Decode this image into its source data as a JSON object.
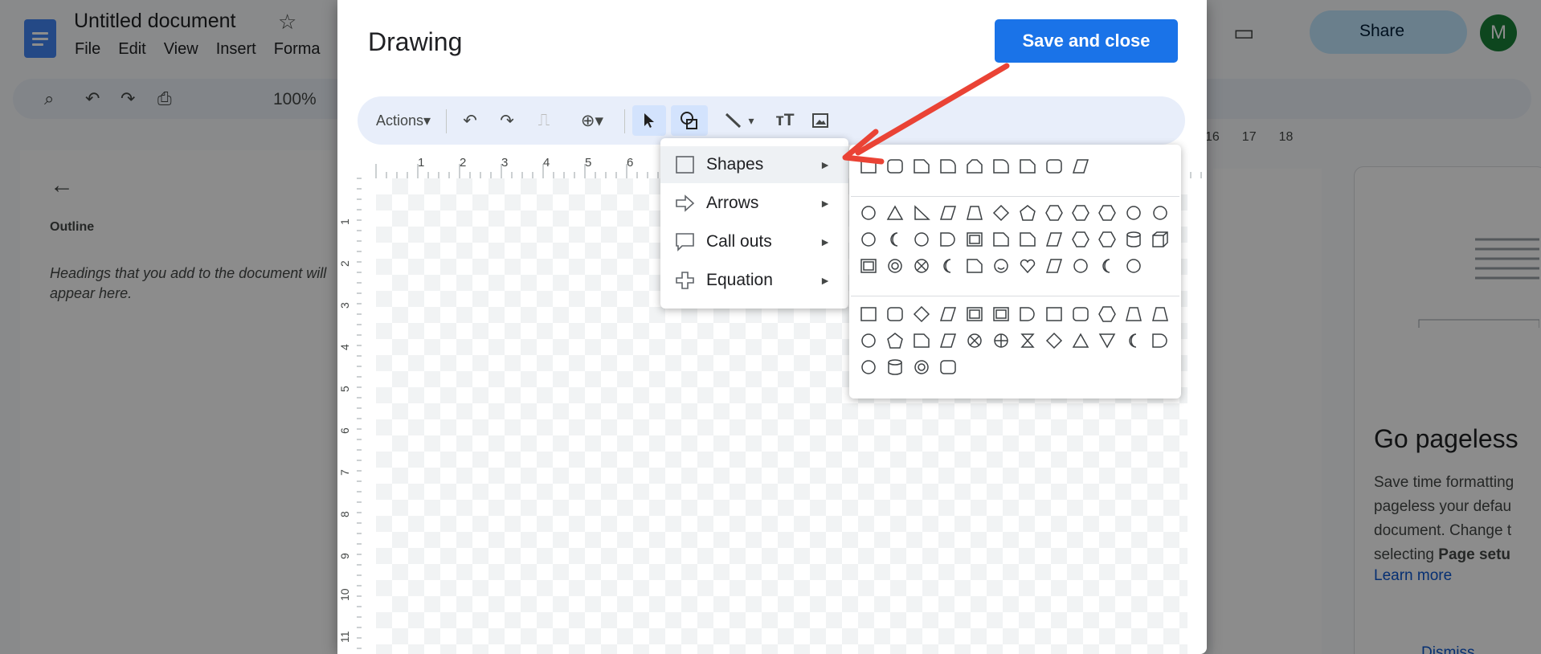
{
  "doc": {
    "title": "Untitled document",
    "menu": [
      "File",
      "Edit",
      "View",
      "Insert",
      "Forma"
    ],
    "zoom": "100%",
    "share_label": "Share",
    "avatar_letter": "M",
    "outline_title": "Outline",
    "outline_text": "Headings that you add to the document will appear here.",
    "ruler_right": [
      "16",
      "17",
      "18"
    ]
  },
  "pageless": {
    "title": "Go pageless",
    "text_line1": "Save time formatting",
    "text_line2": "pageless your defau",
    "text_line3": "document. Change t",
    "text_line4": "selecting ",
    "text_bold": "Page setu",
    "link": "Learn more",
    "dismiss": "Dismiss"
  },
  "drawing": {
    "title": "Drawing",
    "save_label": "Save and close",
    "actions_label": "Actions",
    "h_ruler": [
      "1",
      "2",
      "3",
      "4",
      "5",
      "6"
    ],
    "v_ruler": [
      "1",
      "2",
      "3",
      "4",
      "5",
      "6",
      "7",
      "8",
      "9",
      "10",
      "11"
    ]
  },
  "shape_menu": {
    "items": [
      {
        "label": "Shapes",
        "icon": "square-icon"
      },
      {
        "label": "Arrows",
        "icon": "arrow-icon"
      },
      {
        "label": "Call outs",
        "icon": "callout-icon"
      },
      {
        "label": "Equation",
        "icon": "plus-icon"
      }
    ],
    "submenu_arrow": "►"
  },
  "annotation_color": "#ea4335",
  "accent_color": "#1a73e8"
}
